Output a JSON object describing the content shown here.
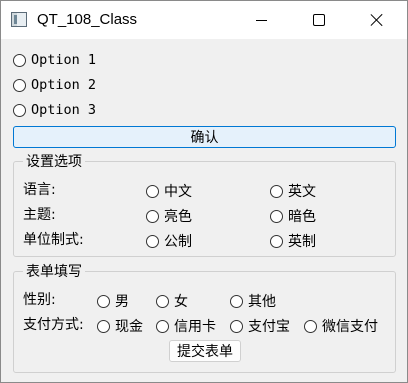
{
  "window": {
    "title": "QT_108_Class"
  },
  "options": [
    "Option 1",
    "Option 2",
    "Option 3"
  ],
  "confirm_label": "确认",
  "settings": {
    "title": "设置选项",
    "language": {
      "label": "语言:",
      "choices": [
        "中文",
        "英文"
      ]
    },
    "theme": {
      "label": "主题:",
      "choices": [
        "亮色",
        "暗色"
      ]
    },
    "units": {
      "label": "单位制式:",
      "choices": [
        "公制",
        "英制"
      ]
    }
  },
  "form": {
    "title": "表单填写",
    "gender": {
      "label": "性别:",
      "choices": [
        "男",
        "女",
        "其他"
      ]
    },
    "payment": {
      "label": "支付方式:",
      "choices": [
        "现金",
        "信用卡",
        "支付宝",
        "微信支付"
      ]
    },
    "submit_label": "提交表单"
  }
}
